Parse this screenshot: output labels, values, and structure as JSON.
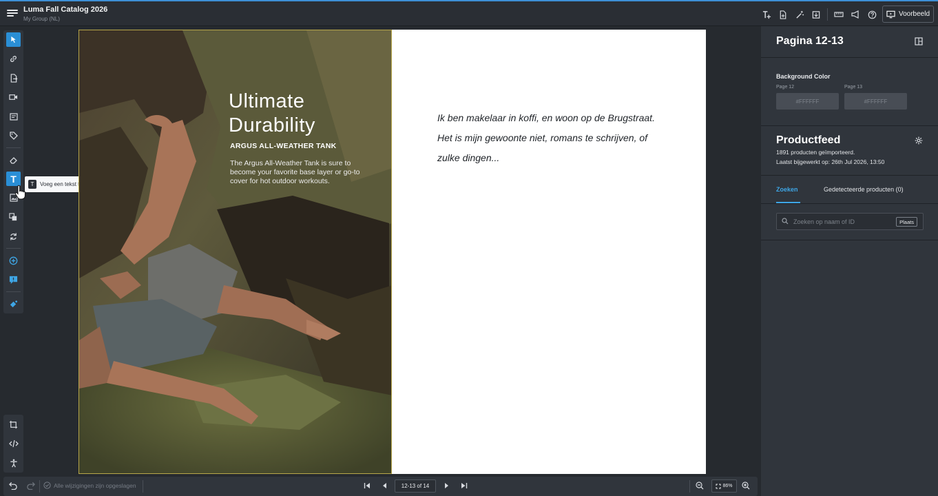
{
  "header": {
    "title": "Luma Fall Catalog 2026",
    "subtitle": "My Group (NL)",
    "preview_label": "Voorbeeld",
    "icons": [
      "add-text-variable-icon",
      "document-plus-icon",
      "magic-wand-icon",
      "download-icon",
      "ruler-icon",
      "megaphone-icon",
      "help-icon",
      "preview-monitor-icon"
    ]
  },
  "toolbar": {
    "tools": [
      "select-arrow-icon",
      "link-icon",
      "export-page-icon",
      "video-icon",
      "template-icon",
      "tag-icon",
      "eraser-icon",
      "text-icon",
      "image-icon",
      "layers-icon",
      "refresh-icon",
      "add-circle-icon",
      "comment-icon",
      "color-fill-icon"
    ],
    "bottom_tools": [
      "crop-icon",
      "code-icon",
      "accessibility-icon"
    ],
    "tooltip": {
      "key": "T",
      "text": "Voeg een tekst toe"
    }
  },
  "spread": {
    "left_page": {
      "headline_line1": "Ultimate",
      "headline_line2": "Durability",
      "subhead": "ARGUS ALL-WEATHER TANK",
      "body": "The Argus All-Weather Tank is sure to become your favorite base layer or go-to cover for hot outdoor workouts."
    },
    "right_page": {
      "quote": "Ik ben makelaar in koffi, en woon op de Brugstraat. Het is mijn gewoonte niet, romans te schrijven, of zulke dingen..."
    }
  },
  "right_panel": {
    "title": "Pagina 12-13",
    "bg_label": "Background Color",
    "page12_label": "Page 12",
    "page13_label": "Page 13",
    "page12_color": "#FFFFFF",
    "page13_color": "#FFFFFF",
    "productfeed_title": "Productfeed",
    "products_imported": "1891 producten geïmporteerd.",
    "last_updated": "Laatst bijgewerkt op: 26th Jul 2026, 13:50",
    "tab_search": "Zoeken",
    "tab_detected": "Gedetecteerde producten (0)",
    "search_placeholder": "Zoeken op naam of ID",
    "search_button": "Plaats"
  },
  "bottombar": {
    "saved_status": "Alle wijzigingen zijn opgeslagen",
    "page_indicator": "12-13 of 14",
    "zoom": "86%"
  },
  "colors": {
    "accent": "#2a8fd6",
    "panel": "#30353c",
    "background": "#262a2f"
  }
}
